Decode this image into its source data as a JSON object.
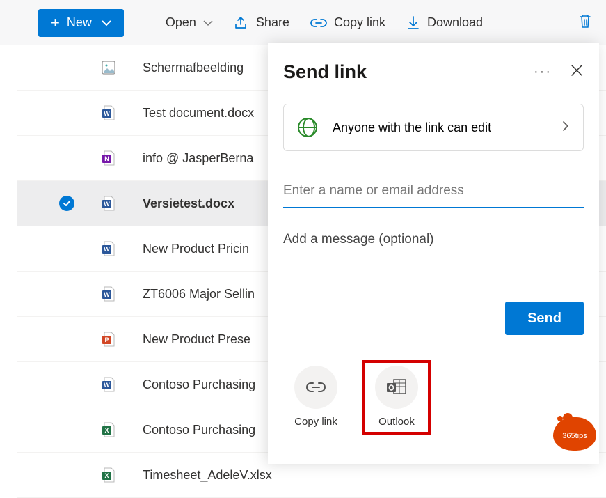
{
  "toolbar": {
    "new_label": "New",
    "open_label": "Open",
    "share_label": "Share",
    "copylink_label": "Copy link",
    "download_label": "Download"
  },
  "files": [
    {
      "name": "Schermafbeelding ",
      "type": "image",
      "selected": false
    },
    {
      "name": "Test document.docx",
      "type": "word",
      "selected": false
    },
    {
      "name": "info @ JasperBerna",
      "type": "onenote",
      "selected": false
    },
    {
      "name": "Versietest.docx",
      "type": "word",
      "selected": true
    },
    {
      "name": "New Product Pricin",
      "type": "word",
      "selected": false
    },
    {
      "name": "ZT6006 Major Sellin",
      "type": "word",
      "selected": false
    },
    {
      "name": "New Product Prese",
      "type": "powerpoint",
      "selected": false
    },
    {
      "name": "Contoso Purchasing",
      "type": "word",
      "selected": false
    },
    {
      "name": "Contoso Purchasing",
      "type": "excel",
      "selected": false
    },
    {
      "name": "Timesheet_AdeleV.xlsx",
      "type": "excel",
      "selected": false
    }
  ],
  "panel": {
    "title": "Send link",
    "permission_text": "Anyone with the link can edit",
    "name_placeholder": "Enter a name or email address",
    "message_placeholder": "Add a message (optional)",
    "send_label": "Send",
    "copylink_label": "Copy link",
    "outlook_label": "Outlook"
  },
  "badge_text": "365tips"
}
